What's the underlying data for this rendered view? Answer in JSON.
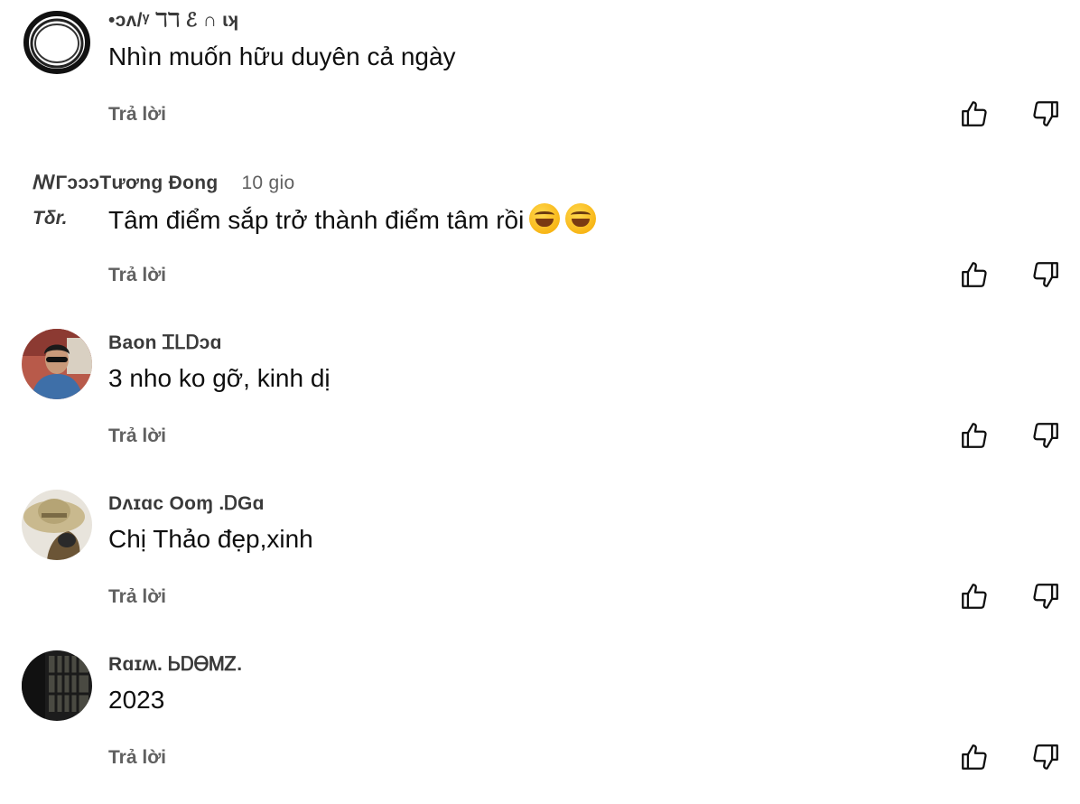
{
  "comments": [
    {
      "author": "•ɔʌ/ᵞ ℸℸ ℰ ∩ ɩʞ",
      "time": "",
      "text": "Nhìn muốn hữu duyên cả ngày",
      "reply_label": "Trả lời",
      "avatar": "ring-avatar"
    },
    {
      "author": "ꟿΓɔɔɔTương Đong",
      "time": "10 gio",
      "side_label": "Tδr.",
      "text": "Tâm điểm sắp trở thành điểm tâm rồi",
      "emojis": [
        "rolling-laughing-emoji",
        "rolling-laughing-emoji"
      ],
      "reply_label": "Trả lời",
      "avatar": "none"
    },
    {
      "author": "Baon ᏆᏞᎠɔɑ",
      "time": "",
      "text": "3 nho ko gỡ, kinh dị",
      "reply_label": "Trả lời",
      "avatar": "photo-man-sunglasses"
    },
    {
      "author": "Dᴧɪɑc Ooɱ .ᎠGɑ",
      "time": "",
      "text": "Chị Thảo đẹp,xinh",
      "reply_label": "Trả lời",
      "avatar": "photo-hat"
    },
    {
      "author": "Rɑɪʍ. ᏏᎠᎾᎷᏃ.",
      "time": "",
      "text": "2023",
      "reply_label": "Trả lời",
      "avatar": "photo-dark-window"
    }
  ],
  "colors": {
    "author": "#3a3a3a",
    "text": "#0f0f0f",
    "secondary": "#606060",
    "background": "#ffffff"
  }
}
